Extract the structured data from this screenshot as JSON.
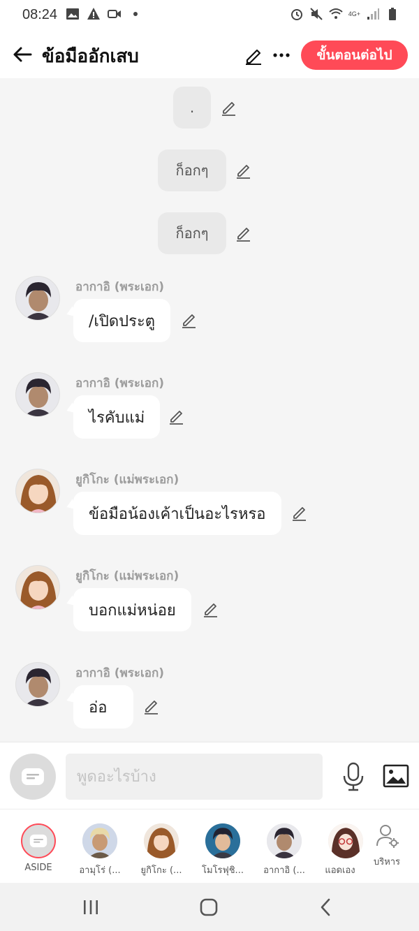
{
  "status_bar": {
    "time": "08:24",
    "network_label": "4G+"
  },
  "header": {
    "title": "ข้อมืออักเสบ",
    "next_button": "ขั้นตอนต่อไป"
  },
  "narration": [
    {
      "text": "."
    },
    {
      "text": "ก็อกๆ"
    },
    {
      "text": "ก็อกๆ"
    }
  ],
  "messages": [
    {
      "sender": "อากาอิ (พระเอก)",
      "text": "/เปิดประตู",
      "avatar": "akai"
    },
    {
      "sender": "อากาอิ (พระเอก)",
      "text": "ไรคับแม่",
      "avatar": "akai"
    },
    {
      "sender": "ยูกิโกะ (แม่พระเอก)",
      "text": "ข้อมือน้องเค้าเป็นอะไรหรอ",
      "avatar": "yukiko"
    },
    {
      "sender": "ยูกิโกะ (แม่พระเอก)",
      "text": "บอกแม่หน่อย",
      "avatar": "yukiko"
    },
    {
      "sender": "อากาอิ (พระเอก)",
      "text": "อ่อ",
      "avatar": "akai"
    }
  ],
  "input": {
    "placeholder": "พูดอะไรบ้าง"
  },
  "characters": [
    {
      "label": "ASIDE",
      "avatar": "aside"
    },
    {
      "label": "อามุโร่ (...",
      "avatar": "amuro"
    },
    {
      "label": "ยูกิโกะ (...",
      "avatar": "yukiko"
    },
    {
      "label": "โมโรฟุชิ...",
      "avatar": "morofushi"
    },
    {
      "label": "อากาอิ (...",
      "avatar": "akai"
    },
    {
      "label": "แอดเอง",
      "avatar": "admin"
    },
    {
      "label": "บริหาร",
      "avatar": "manage"
    }
  ],
  "colors": {
    "accent": "#ff4a57",
    "bubble": "#ffffff",
    "narration_bg": "#e9e9e9",
    "chat_bg": "#f5f5f5"
  }
}
